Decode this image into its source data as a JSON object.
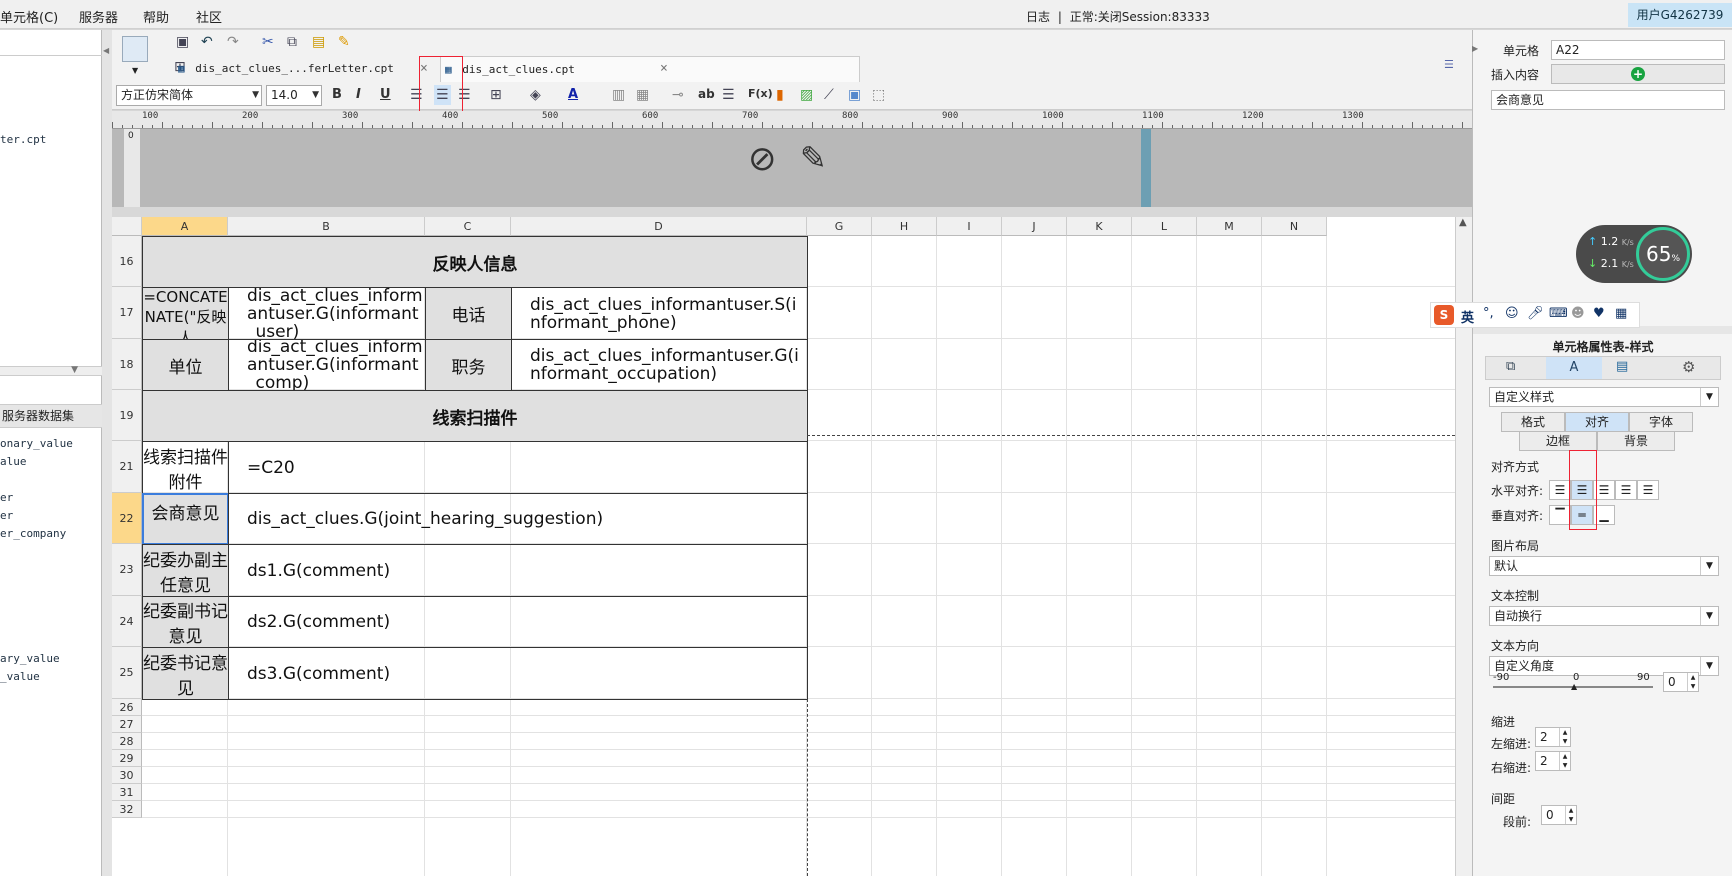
{
  "menubar": {
    "items": [
      "单元格(C)",
      "服务器",
      "帮助",
      "社区"
    ],
    "log": "日志",
    "separator": "|",
    "status": "正常:关闭Session:83333",
    "user": "用户G4262739"
  },
  "left_panel": {
    "file_fragment": "ter.cpt",
    "server_dataset_label": "服务器数据集",
    "items_top": [
      "onary_value",
      "alue",
      "er",
      "er",
      "er_company"
    ],
    "items_bottom": [
      "ary_value",
      "_value"
    ]
  },
  "tabs": [
    {
      "label": "dis_act_clues_...ferLetter.cpt",
      "close": "×"
    },
    {
      "label": "dis_act_clues.cpt",
      "close": "×"
    }
  ],
  "format_toolbar": {
    "font_family": "方正仿宋简体",
    "font_size": "14.0",
    "bold": "B",
    "italic": "I",
    "underline": "U",
    "font_color": "A",
    "ab_label": "ab",
    "formula_label": "F(x)"
  },
  "ruler": {
    "ticks": [
      "100",
      "200",
      "300",
      "400",
      "500",
      "600",
      "700",
      "800",
      "900",
      "1000",
      "1100",
      "1200",
      "1300"
    ],
    "zero": "0"
  },
  "grid": {
    "columns": [
      "A",
      "B",
      "C",
      "D",
      "G",
      "H",
      "I",
      "J",
      "K",
      "L",
      "M",
      "N"
    ],
    "rows": [
      "16",
      "17",
      "18",
      "19",
      "21",
      "22",
      "23",
      "24",
      "25",
      "26",
      "27",
      "28",
      "29",
      "30",
      "31",
      "32"
    ],
    "cells": {
      "r16": "反映人信息",
      "r17a": "=CONCATENATE(\"反映人",
      "r17b": "dis_act_clues_informantuser.G(informant_user)",
      "r17c": "电话",
      "r17d": "dis_act_clues_informantuser.S(informant_phone)",
      "r18a": "单位",
      "r18b": "dis_act_clues_informantuser.G(informant_comp)",
      "r18c": "职务",
      "r18d": "dis_act_clues_informantuser.G(informant_occupation)",
      "r19": "线索扫描件",
      "r21a": "线索扫描件附件",
      "r21b": "=C20",
      "r22a": "会商意见",
      "r22b": "dis_act_clues.G(joint_hearing_suggestion)",
      "r23a": "纪委办副主任意见",
      "r23b": "ds1.G(comment)",
      "r24a": "纪委副书记意见",
      "r24b": "ds2.G(comment)",
      "r25a": "纪委书记意见",
      "r25b": "ds3.G(comment)"
    }
  },
  "right_panel": {
    "cell_label": "单元格",
    "cell_value": "A22",
    "insert_label": "插入内容",
    "insert_value": "会商意见",
    "panel_title": "单元格属性表-样式",
    "style_select": "自定义样式",
    "subtabs_row1": [
      "格式",
      "对齐",
      "字体"
    ],
    "subtabs_row2": [
      "边框",
      "背景"
    ],
    "align_section": "对齐方式",
    "h_align_label": "水平对齐:",
    "v_align_label": "垂直对齐:",
    "image_layout_label": "图片布局",
    "image_layout_value": "默认",
    "text_control_label": "文本控制",
    "text_control_value": "自动换行",
    "text_dir_label": "文本方向",
    "text_dir_value": "自定义角度",
    "angle_min": "-90",
    "angle_mid": "0",
    "angle_max": "90",
    "angle_value": "0",
    "indent_label": "缩进",
    "left_indent_label": "左缩进:",
    "left_indent_value": "2",
    "right_indent_label": "右缩进:",
    "right_indent_value": "2",
    "spacing_label": "间距",
    "before_label": "段前:",
    "before_value": "0"
  },
  "speed_widget": {
    "up": "1.2",
    "down": "2.1",
    "unit": "K/s",
    "percent": "65",
    "percent_sign": "%"
  },
  "ime_bar": {
    "lang": "英"
  }
}
